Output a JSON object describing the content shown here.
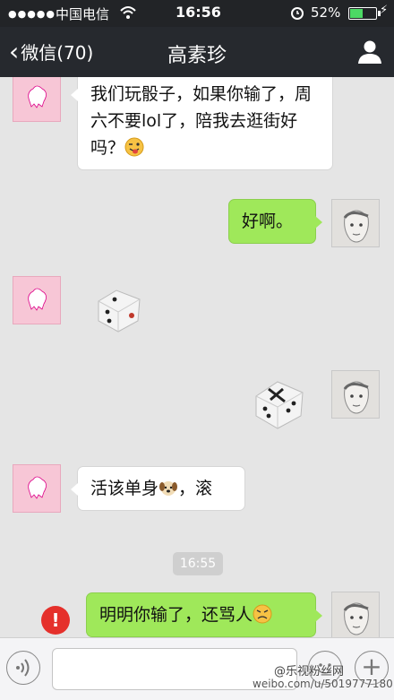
{
  "status_bar": {
    "signal": "●●●●●",
    "carrier": "中国电信",
    "time": "16:56",
    "battery_percent": "52%",
    "battery_level": 0.52
  },
  "nav": {
    "back_label": "微信(70)",
    "title": "高素珍"
  },
  "messages": [
    {
      "side": "left",
      "type": "text",
      "text": "我们玩骰子，如果你输了，周六不要lol了，陪我去逛街好吗？",
      "emoji": "tongue-wink-emoji"
    },
    {
      "side": "right",
      "type": "text",
      "text": "好啊。"
    },
    {
      "side": "left",
      "type": "dice"
    },
    {
      "side": "right",
      "type": "dice"
    },
    {
      "side": "left",
      "type": "text",
      "text_before": "活该单身",
      "emoji": "dog-emoji",
      "text_after": "，滚"
    },
    {
      "side": "right",
      "type": "text",
      "text": "明明你输了，还骂人",
      "emoji": "sad-emoji",
      "status": "failed"
    }
  ],
  "timestamp": "16:55",
  "error_badge": "!",
  "input": {
    "value": ""
  },
  "watermark": {
    "line1": "@乐视粉丝网",
    "line2": "weibo.com/u/5019777180"
  }
}
